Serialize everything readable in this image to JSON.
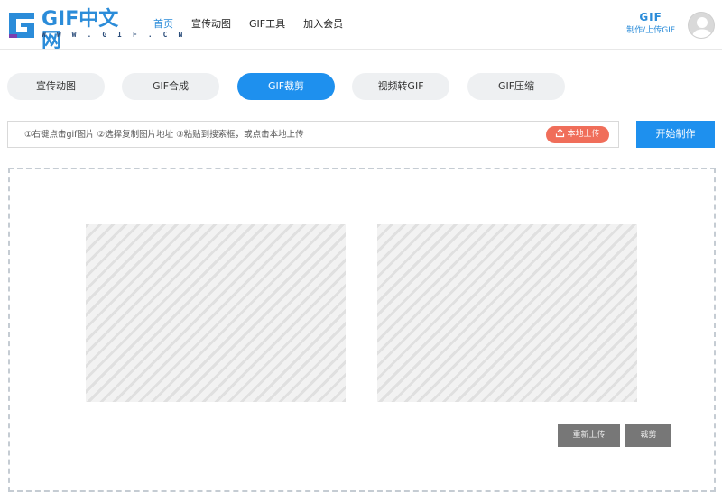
{
  "logo": {
    "text": "GIF中文网",
    "subtext": "W W W . G I F . C N"
  },
  "nav": [
    {
      "label": "首页",
      "active": true
    },
    {
      "label": "宣传动图",
      "active": false
    },
    {
      "label": "GIF工具",
      "active": false
    },
    {
      "label": "加入会员",
      "active": false
    }
  ],
  "user": {
    "badge": "GIF",
    "action": "制作/上传GIF"
  },
  "tabs": [
    {
      "label": "宣传动图",
      "active": false
    },
    {
      "label": "GIF合成",
      "active": false
    },
    {
      "label": "GIF裁剪",
      "active": true
    },
    {
      "label": "视频转GIF",
      "active": false
    },
    {
      "label": "GIF压缩",
      "active": false
    }
  ],
  "urlbar": {
    "placeholder": "①右键点击gif图片 ②选择复制图片地址 ③粘贴到搜索框，或点击本地上传",
    "upload_label": "本地上传"
  },
  "start_label": "开始制作",
  "workarea": {
    "reupload_label": "重新上传",
    "crop_label": "裁剪"
  },
  "colors": {
    "accent": "#1e90ee",
    "upload": "#f06e5a",
    "dark_button": "#777777"
  }
}
